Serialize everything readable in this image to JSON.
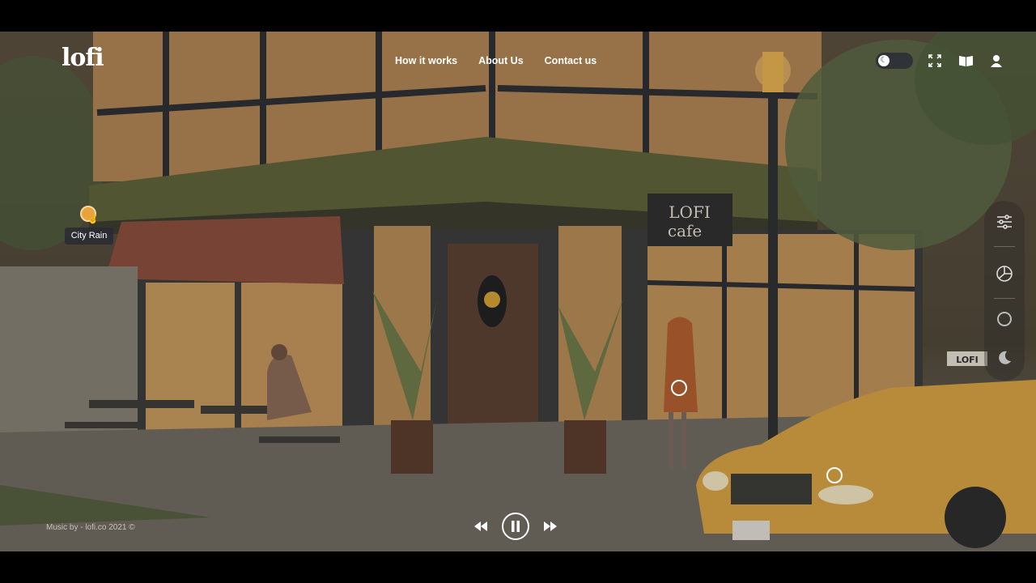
{
  "header": {
    "logo_text": "lofi",
    "nav": [
      {
        "label": "How it works"
      },
      {
        "label": "About Us"
      },
      {
        "label": "Contact us"
      }
    ],
    "theme_toggle": {
      "mode": "night",
      "icon": "moon-icon"
    },
    "toolbar_icons": [
      "fullscreen-icon",
      "book-icon",
      "user-icon"
    ]
  },
  "scene": {
    "cafe_sign_line1": "LOFI",
    "cafe_sign_line2": "cafe",
    "taxi_sign": "LOFI"
  },
  "hotspots": {
    "active_label": "City Rain"
  },
  "tool_rail": {
    "icons": [
      "sliders-icon",
      "mixer-icon",
      "circle-icon",
      "moon-icon"
    ]
  },
  "footer": {
    "credit": "Music by - lofi.co 2021 ©"
  },
  "player": {
    "state": "playing",
    "icons": [
      "previous-icon",
      "pause-icon",
      "next-icon"
    ]
  },
  "colors": {
    "accent": "#e8a43a",
    "window_glow": "#c99a5c",
    "taxi": "#d9a441"
  }
}
